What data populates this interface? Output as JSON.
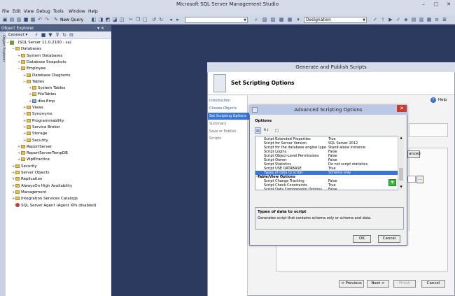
{
  "window": {
    "title": "Microsoft SQL Server Management Studio",
    "minimize": "–",
    "maximize": "□",
    "close": "✕"
  },
  "menu": [
    "File",
    "Edit",
    "View",
    "Debug",
    "Tools",
    "Window",
    "Help"
  ],
  "toolbar": {
    "new_query": "New Query",
    "designation": "Designation"
  },
  "object_explorer": {
    "title": "Object Explorer",
    "pin": "▾ ✕",
    "connect": "Connect ▾",
    "vertical_tab": "Object Explorer",
    "tree": [
      {
        "label": ". (SQL Server 11.0.2100 - sa)",
        "level": 0,
        "icon": "server",
        "expander": "−"
      },
      {
        "label": "Databases",
        "level": 1,
        "icon": "folder",
        "expander": "−"
      },
      {
        "label": "System Databases",
        "level": 2,
        "icon": "folder",
        "expander": "+"
      },
      {
        "label": "Database Snapshots",
        "level": 2,
        "icon": "folder",
        "expander": "+"
      },
      {
        "label": "Employee",
        "level": 2,
        "icon": "folder",
        "expander": "−"
      },
      {
        "label": "Database Diagrams",
        "level": 3,
        "icon": "folder",
        "expander": "+"
      },
      {
        "label": "Tables",
        "level": 3,
        "icon": "folder",
        "expander": "−"
      },
      {
        "label": "System Tables",
        "level": 4,
        "icon": "folder",
        "expander": "+"
      },
      {
        "label": "FileTables",
        "level": 4,
        "icon": "folder",
        "expander": "+"
      },
      {
        "label": "dbo.Emp",
        "level": 4,
        "icon": "table",
        "expander": "+"
      },
      {
        "label": "Views",
        "level": 3,
        "icon": "folder",
        "expander": "+"
      },
      {
        "label": "Synonyms",
        "level": 3,
        "icon": "folder",
        "expander": "+"
      },
      {
        "label": "Programmability",
        "level": 3,
        "icon": "folder",
        "expander": "+"
      },
      {
        "label": "Service Broker",
        "level": 3,
        "icon": "folder",
        "expander": "+"
      },
      {
        "label": "Storage",
        "level": 3,
        "icon": "folder",
        "expander": "+"
      },
      {
        "label": "Security",
        "level": 3,
        "icon": "folder",
        "expander": "+"
      },
      {
        "label": "ReportServer",
        "level": 2,
        "icon": "folder",
        "expander": "+"
      },
      {
        "label": "ReportServerTempDB",
        "level": 2,
        "icon": "folder",
        "expander": "+"
      },
      {
        "label": "WpfPractice",
        "level": 2,
        "icon": "folder",
        "expander": "+"
      },
      {
        "label": "Security",
        "level": 1,
        "icon": "folder",
        "expander": "+"
      },
      {
        "label": "Server Objects",
        "level": 1,
        "icon": "folder",
        "expander": "+"
      },
      {
        "label": "Replication",
        "level": 1,
        "icon": "folder",
        "expander": "+"
      },
      {
        "label": "AlwaysOn High Availability",
        "level": 1,
        "icon": "folder",
        "expander": "+"
      },
      {
        "label": "Management",
        "level": 1,
        "icon": "folder",
        "expander": "+"
      },
      {
        "label": "Integration Services Catalogs",
        "level": 1,
        "icon": "folder",
        "expander": "+"
      },
      {
        "label": "SQL Server Agent (Agent XPs disabled)",
        "level": 1,
        "icon": "agent",
        "expander": ""
      }
    ]
  },
  "generate_publish": {
    "title": "Generate and Publish Scripts",
    "header": "Set Scripting Options",
    "help": "Help",
    "nav": [
      "Introduction",
      "Choose Objects",
      "Set Scripting Options",
      "Summary",
      "Save or Publish Scripts"
    ],
    "nav_selected": 2,
    "advanced_partial": "anced",
    "buttons": {
      "previous": "< Previous",
      "next": "Next >",
      "finish": "Finish",
      "cancel": "Cancel"
    }
  },
  "advanced_options": {
    "title": "Advanced Scripting Options",
    "close": "✕",
    "options_label": "Options",
    "rows": [
      {
        "name": "Script Extended Properties",
        "value": "True"
      },
      {
        "name": "Script for Server Version",
        "value": "SQL Server 2012"
      },
      {
        "name": "Script for the database engine type",
        "value": "Stand-alone instance"
      },
      {
        "name": "Script Logins",
        "value": "False"
      },
      {
        "name": "Script Object-Level Permissions",
        "value": "False"
      },
      {
        "name": "Script Owner",
        "value": "False"
      },
      {
        "name": "Script Statistics",
        "value": "Do not script statistics"
      },
      {
        "name": "Script USE DATABASE",
        "value": "True"
      },
      {
        "name": "Types of data to script",
        "value": "Schema only",
        "selected": true
      },
      {
        "name": "Table/View Options",
        "value": "",
        "category": true
      },
      {
        "name": "Script Change Tracking",
        "value": "False"
      },
      {
        "name": "Script Check Constraints",
        "value": "True"
      },
      {
        "name": "Script Data Compression Options",
        "value": "False"
      }
    ],
    "description_title": "Types of data to script",
    "description": "Generates script that contains schema only or schema and data.",
    "ok": "OK",
    "cancel": "Cancel"
  }
}
